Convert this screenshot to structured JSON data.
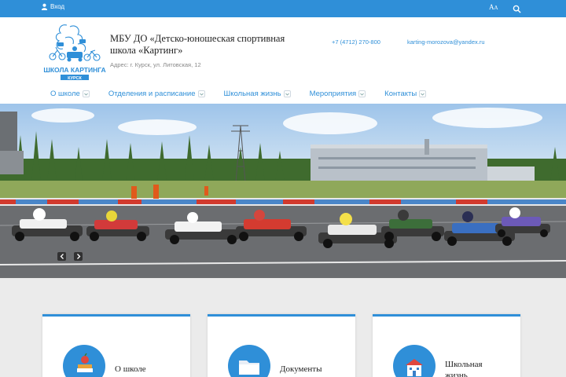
{
  "topbar": {
    "login_label": "Вход",
    "font_size_label_big": "A",
    "font_size_label_small": "A"
  },
  "header": {
    "logo_text_top": "ШКОЛА КАРТИНГА",
    "logo_text_bottom": "КУРСК",
    "school_name": "МБУ ДО «Детско-юношеская спортивная школа «Картинг»",
    "address": "Адрес: г. Курск, ул. Литовская, 12",
    "phone": "+7 (4712) 270-800",
    "email": "karting-morozova@yandex.ru"
  },
  "nav": {
    "items": [
      {
        "label": "О школе"
      },
      {
        "label": "Отделения и расписание"
      },
      {
        "label": "Школьная жизнь"
      },
      {
        "label": "Мероприятия"
      },
      {
        "label": "Контакты"
      }
    ]
  },
  "cards": [
    {
      "title": "О школе"
    },
    {
      "title": "Документы"
    },
    {
      "title": "Школьная жизнь"
    }
  ],
  "colors": {
    "accent": "#2f8fd8"
  }
}
